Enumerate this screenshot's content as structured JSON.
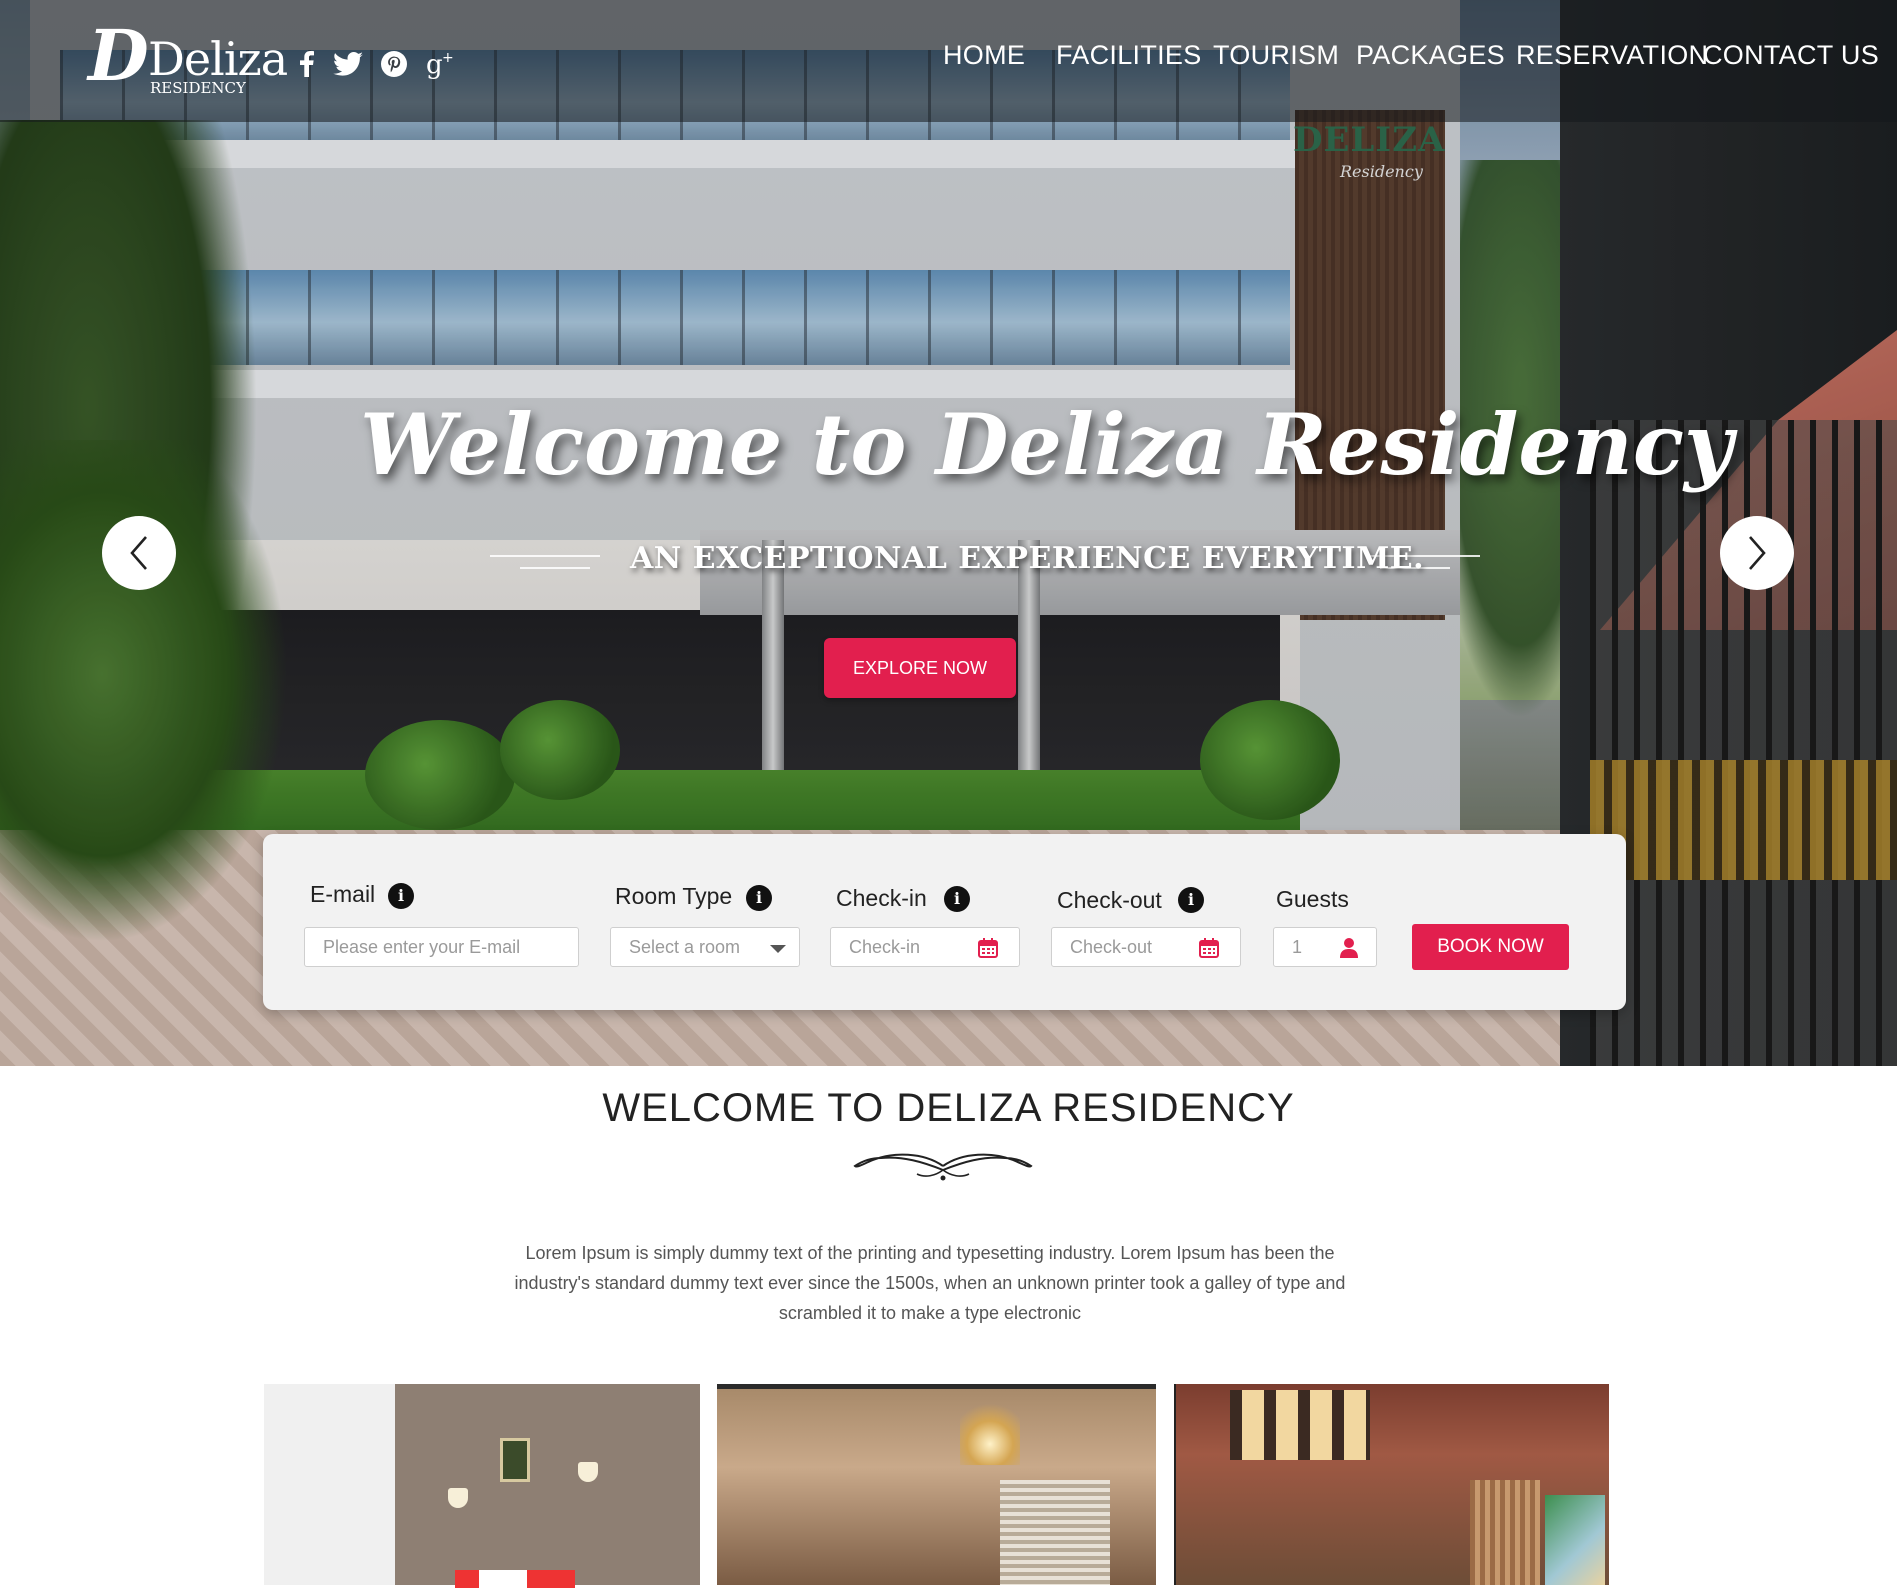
{
  "header": {
    "logo": {
      "mark": "D",
      "name": "Deliza",
      "sub": "RESIDENCY"
    },
    "social": [
      {
        "name": "facebook-icon"
      },
      {
        "name": "twitter-icon"
      },
      {
        "name": "pinterest-icon"
      },
      {
        "name": "google-plus-icon"
      }
    ],
    "nav": [
      "HOME",
      "FACILITIES",
      "TOURISM",
      "PACKAGES",
      "RESERVATION",
      "CONTACT US"
    ]
  },
  "hero": {
    "building_sign": "DELIZA",
    "building_sign_script": "Residency",
    "headline": "Welcome to Deliza Residency",
    "tagline": "AN EXCEPTIONAL EXPERIENCE EVERYTIME.",
    "cta": "EXPLORE NOW",
    "prev_icon": "chevron-left-icon",
    "next_icon": "chevron-right-icon"
  },
  "booking": {
    "email": {
      "label": "E-mail",
      "placeholder": "Please enter your E-mail"
    },
    "room": {
      "label": "Room Type",
      "placeholder": "Select a room"
    },
    "checkin": {
      "label": "Check-in",
      "placeholder": "Check-in"
    },
    "checkout": {
      "label": "Check-out",
      "placeholder": "Check-out"
    },
    "guests": {
      "label": "Guests",
      "value": "1"
    },
    "submit": "BOOK NOW",
    "info_glyph": "i"
  },
  "welcome": {
    "title": "WELCOME TO DELIZA RESIDENCY",
    "text": "Lorem Ipsum is simply dummy text of the printing and typesetting industry. Lorem Ipsum has been the industry's standard dummy text ever since the 1500s, when an unknown printer took a galley of type and scrambled it to make a type electronic"
  },
  "colors": {
    "accent": "#e21f4e",
    "text": "#222222",
    "muted": "#555555"
  }
}
